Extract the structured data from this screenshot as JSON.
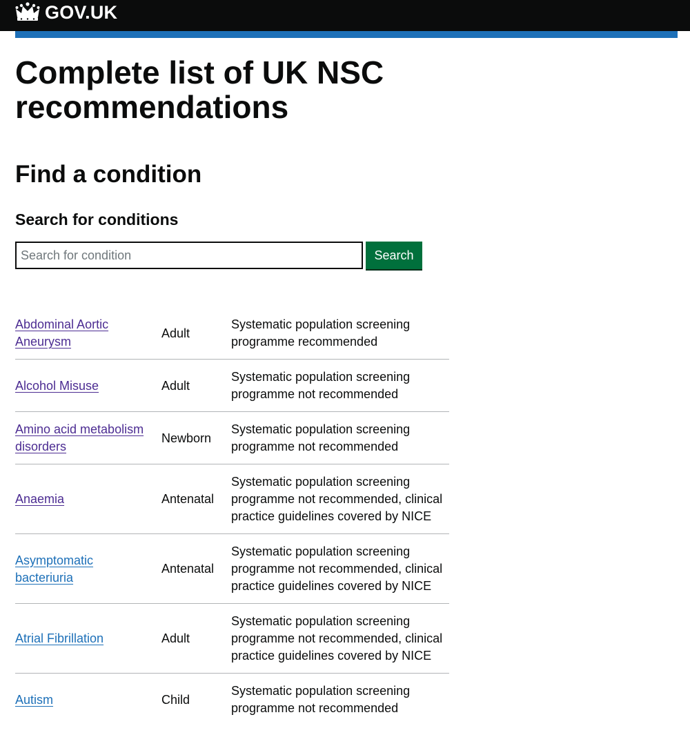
{
  "header": {
    "logo_text": "GOV.UK",
    "crown_icon": "crown-icon",
    "background_color": "#0b0c0c",
    "accent_bar_color": "#1d70b8"
  },
  "page_title": "Complete list of UK NSC recommendations",
  "section_title": "Find a condition",
  "search": {
    "label": "Search for conditions",
    "placeholder": "Search for condition",
    "value": "",
    "button_label": "Search",
    "button_color": "#00703c"
  },
  "link_colors": {
    "visited": "#4c2c92",
    "unvisited": "#1d70b8"
  },
  "conditions": [
    {
      "name": "Abdominal Aortic Aneurysm",
      "age": "Adult",
      "recommendation": "Systematic population screening programme recommended",
      "visited": true
    },
    {
      "name": "Alcohol Misuse",
      "age": "Adult",
      "recommendation": "Systematic population screening programme not recommended",
      "visited": true
    },
    {
      "name": "Amino acid metabolism disorders",
      "age": "Newborn",
      "recommendation": "Systematic population screening programme not recommended",
      "visited": true
    },
    {
      "name": "Anaemia",
      "age": "Antenatal",
      "recommendation": "Systematic population screening programme not recommended, clinical practice guidelines covered by NICE",
      "visited": true
    },
    {
      "name": "Asymptomatic bacteriuria",
      "age": "Antenatal",
      "recommendation": "Systematic population screening programme not recommended, clinical practice guidelines covered by NICE",
      "visited": false
    },
    {
      "name": "Atrial Fibrillation",
      "age": "Adult",
      "recommendation": "Systematic population screening programme not recommended, clinical practice guidelines covered by NICE",
      "visited": false
    },
    {
      "name": "Autism",
      "age": "Child",
      "recommendation": "Systematic population screening programme not recommended",
      "visited": false
    }
  ]
}
